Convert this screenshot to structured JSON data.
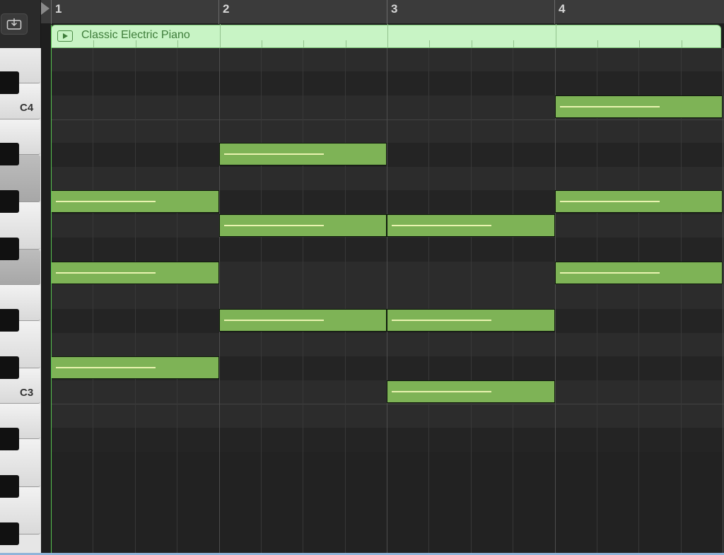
{
  "ruler": {
    "bars": [
      "1",
      "2",
      "3",
      "4"
    ]
  },
  "region": {
    "name": "Classic Electric Piano",
    "color": "#c8f4c5"
  },
  "keyboard": {
    "labels": [
      "C4",
      "C3"
    ]
  },
  "icons": {
    "catch": "download-into-tray-icon",
    "region_play": "play-icon"
  },
  "notes": [
    {
      "pitch": "C4",
      "bar": 4,
      "length_beats": 4
    },
    {
      "pitch": "A#3",
      "bar": 2,
      "length_beats": 4
    },
    {
      "pitch": "G#3",
      "bar": 1,
      "length_beats": 4
    },
    {
      "pitch": "G#3",
      "bar": 4,
      "length_beats": 4
    },
    {
      "pitch": "G3",
      "bar": 2,
      "length_beats": 4
    },
    {
      "pitch": "G3",
      "bar": 3,
      "length_beats": 4
    },
    {
      "pitch": "F3",
      "bar": 1,
      "length_beats": 4
    },
    {
      "pitch": "F3",
      "bar": 4,
      "length_beats": 4
    },
    {
      "pitch": "D#3",
      "bar": 2,
      "length_beats": 4
    },
    {
      "pitch": "D#3",
      "bar": 3,
      "length_beats": 4
    },
    {
      "pitch": "C#3",
      "bar": 1,
      "length_beats": 4
    },
    {
      "pitch": "C3",
      "bar": 3,
      "length_beats": 4
    }
  ]
}
